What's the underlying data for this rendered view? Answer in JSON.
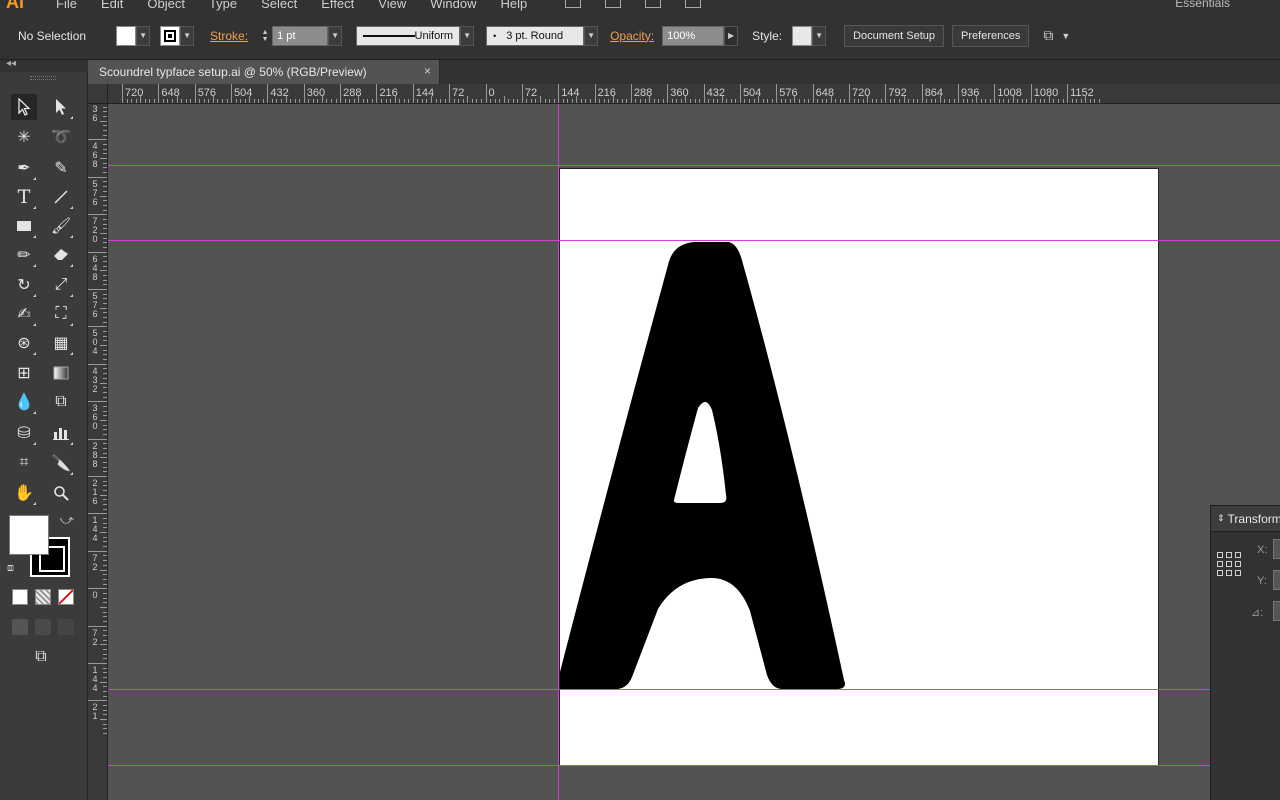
{
  "menubar": {
    "app_logo": "Ai",
    "items": [
      "File",
      "Edit",
      "Object",
      "Type",
      "Select",
      "Effect",
      "View",
      "Window",
      "Help"
    ],
    "workspace": "Essentials"
  },
  "control": {
    "selection_label": "No Selection",
    "stroke_label": "Stroke:",
    "stroke_weight": "1 pt",
    "profile_label": "Uniform",
    "brush_label": "3 pt. Round",
    "opacity_label": "Opacity:",
    "opacity_value": "100%",
    "style_label": "Style:",
    "document_setup": "Document Setup",
    "preferences": "Preferences"
  },
  "document": {
    "tab_title": "Scoundrel typface setup.ai @ 50% (RGB/Preview)",
    "close_glyph": "×"
  },
  "ruler": {
    "h_labels": [
      "720",
      "648",
      "576",
      "504",
      "432",
      "360",
      "288",
      "216",
      "144",
      "72",
      "0",
      "72",
      "144",
      "216",
      "288",
      "360",
      "432",
      "504",
      "576",
      "648",
      "720",
      "792",
      "864",
      "936",
      "1008",
      "1080",
      "1152"
    ],
    "v_groups": [
      [
        "3",
        "6"
      ],
      [
        "4",
        "6",
        "8"
      ],
      [
        "5",
        "7",
        "6"
      ],
      [
        "7",
        "2",
        "0"
      ],
      [
        "6",
        "4",
        "8"
      ],
      [
        "5",
        "7",
        "6"
      ],
      [
        "5",
        "0",
        "4"
      ],
      [
        "4",
        "3",
        "2"
      ],
      [
        "3",
        "6",
        "0"
      ],
      [
        "2",
        "8",
        "8"
      ],
      [
        "2",
        "1",
        "6"
      ],
      [
        "1",
        "4",
        "4"
      ],
      [
        "7",
        "2"
      ],
      [
        "0"
      ],
      [
        "7",
        "2"
      ],
      [
        "1",
        "4",
        "4"
      ],
      [
        "2",
        "1"
      ]
    ]
  },
  "transform_panel": {
    "title": "Transform",
    "x_label": "X:",
    "y_label": "Y:",
    "angle_label": "⊿:"
  },
  "colors": {
    "guide": "#d23fd2",
    "accent_orange": "#f0a04b",
    "glyph": "#000000"
  }
}
